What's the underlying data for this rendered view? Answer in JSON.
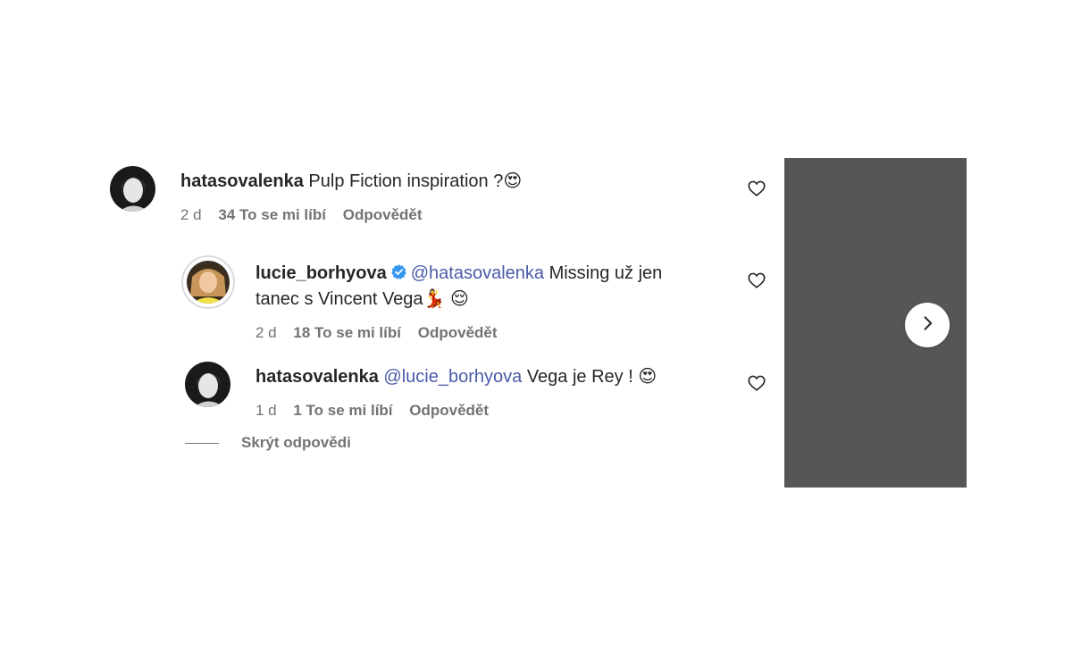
{
  "comments": [
    {
      "username": "hatasovalenka",
      "text": "Pulp Fiction inspiration ?",
      "emoji": "😍",
      "time": "2 d",
      "likes": "34 To se mi líbí",
      "reply": "Odpovědět"
    },
    {
      "username": "lucie_borhyova",
      "verified": true,
      "mention": "@hatasovalenka",
      "text_line1": " Missing už jen",
      "text_line2": "tanec s Vincent Vega",
      "emoji1": "💃",
      "emoji2": "😌",
      "time": "2 d",
      "likes": "18 To se mi líbí",
      "reply": "Odpovědět"
    },
    {
      "username": "hatasovalenka",
      "mention": "@lucie_borhyova",
      "text": " Vega je Rey ! ",
      "emoji": "😍",
      "time": "1 d",
      "likes": "1 To se mi líbí",
      "reply": "Odpovědět"
    }
  ],
  "hide_replies_label": "Skrýt odpovědi",
  "icons": {
    "like": "heart-outline-icon",
    "next": "chevron-right-icon",
    "verified": "verified-badge-icon"
  },
  "colors": {
    "mention": "#4b5aa8",
    "verified": "#3797f0",
    "panel": "#545658",
    "meta": "#737373"
  }
}
